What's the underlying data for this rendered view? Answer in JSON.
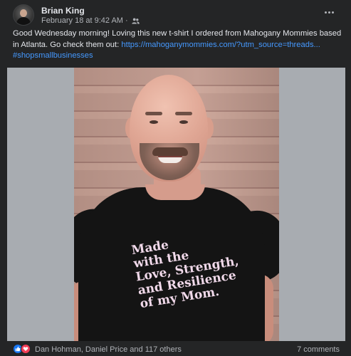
{
  "post": {
    "author": "Brian King",
    "date": "February 18 at 9:42 AM",
    "separator": "·",
    "audience_icon": "friends-icon",
    "text_main": "Good Wednesday morning! Loving this new t-shirt I ordered from Mahogany Mommies based in Atlanta. Go check them out: ",
    "link": "https://mahoganymommies.com/?utm_source=threads...",
    "hashtag": "#shopsmallbusinesses",
    "shirt_lines": [
      "Made",
      "with the",
      "Love, Strength,",
      "and Resilience",
      "of my Mom."
    ]
  },
  "footer": {
    "reaction_icons": [
      "like-icon",
      "love-icon"
    ],
    "reactors": "Dan Hohman, Daniel Price and 117 others",
    "comments": "7 comments"
  },
  "colors": {
    "background": "#242526",
    "link": "#4599ff",
    "like": "#1877f2",
    "love": "#f33e58"
  }
}
